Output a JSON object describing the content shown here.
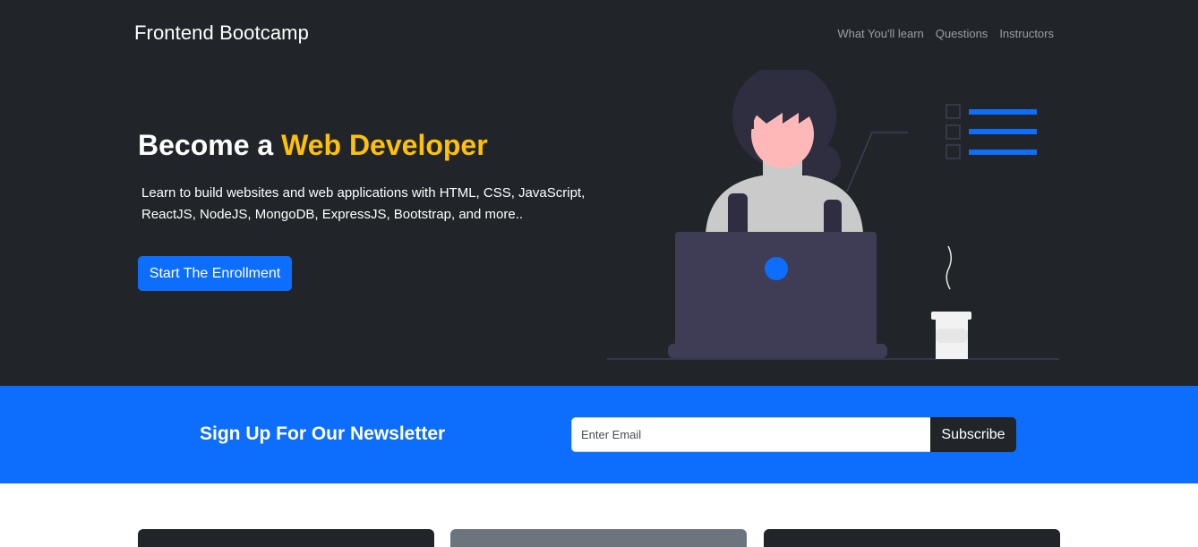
{
  "navbar": {
    "brand": "Frontend Bootcamp",
    "links": [
      "What You'll learn",
      "Questions",
      "Instructors"
    ]
  },
  "hero": {
    "title_prefix": "Become a ",
    "title_accent": "Web Developer",
    "lead": "Learn to build websites and web applications with HTML, CSS, JavaScript, ReactJS, NodeJS, MongoDB, ExpressJS, Bootstrap, and more..",
    "cta_label": "Start The Enrollment",
    "accent_color": "#ffc107"
  },
  "newsletter": {
    "title": "Sign Up For Our Newsletter",
    "email_placeholder": "Enter Email",
    "email_value": "",
    "subscribe_label": "Subscribe",
    "background_color": "#0d6efd"
  },
  "colors": {
    "dark": "#212529",
    "primary": "#0d6efd",
    "secondary": "#6c757d"
  },
  "illustration": {
    "icon": "developer-at-laptop-illustration"
  }
}
